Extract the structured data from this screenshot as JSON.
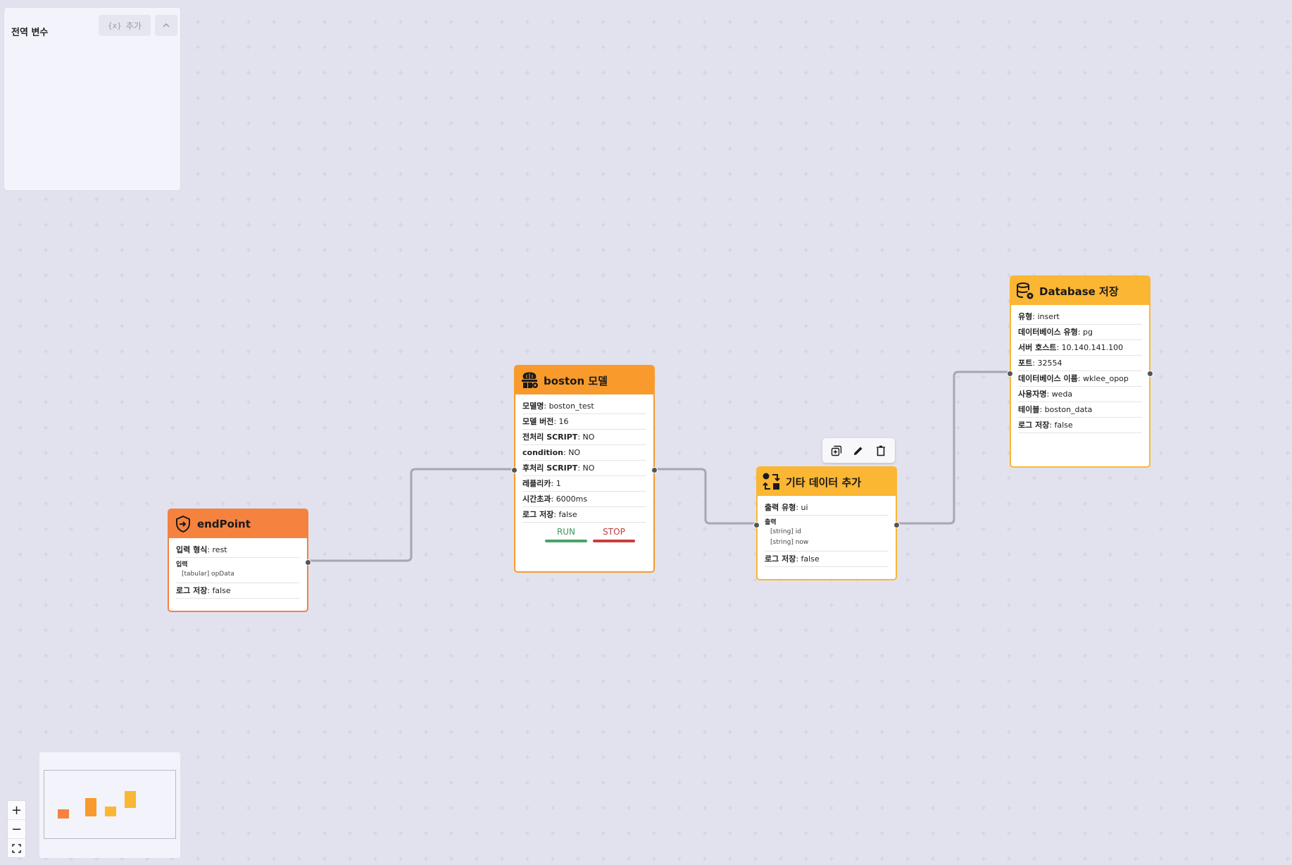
{
  "global_vars": {
    "title": "전역 변수",
    "add_icon_text": "{x}",
    "add_label": "추가"
  },
  "nodes": {
    "endpoint": {
      "title": "endPoint",
      "icon": "shield-enter-icon",
      "rows": [
        {
          "key": "입력 형식",
          "value": "rest"
        }
      ],
      "input": {
        "label": "입력",
        "items": [
          "[tabular]  opData"
        ]
      },
      "log": {
        "key": "로그 저장",
        "value": "false"
      }
    },
    "boston": {
      "title": "boston 모델",
      "icon": "brain-gear-icon",
      "rows": [
        {
          "key": "모델명",
          "value": "boston_test"
        },
        {
          "key": "모델 버전",
          "value": "16"
        },
        {
          "key": "전처리 SCRIPT",
          "value": "NO"
        },
        {
          "key": "condition",
          "value": "NO"
        },
        {
          "key": "후처리 SCRIPT",
          "value": "NO"
        },
        {
          "key": "레플리카",
          "value": "1"
        },
        {
          "key": "시간초과",
          "value": "6000ms"
        },
        {
          "key": "로그 저장",
          "value": "false"
        }
      ],
      "run_label": "RUN",
      "stop_label": "STOP"
    },
    "other_data": {
      "title": "기타 데이터 추가",
      "icon": "shapes-transform-icon",
      "rows": [
        {
          "key": "출력 유형",
          "value": "ui"
        }
      ],
      "output": {
        "label": "출력",
        "items": [
          "[string]  id",
          "[string]  now"
        ]
      },
      "log": {
        "key": "로그 저장",
        "value": "false"
      }
    },
    "database": {
      "title": "Database 저장",
      "icon": "database-gear-icon",
      "rows": [
        {
          "key": "유형",
          "value": "insert"
        },
        {
          "key": "데이터베이스 유형",
          "value": "pg"
        },
        {
          "key": "서버 호스트",
          "value": "10.140.141.100"
        },
        {
          "key": "포트",
          "value": "32554"
        },
        {
          "key": "데이터베이스 이름",
          "value": "wklee_opop"
        },
        {
          "key": "사용자명",
          "value": "weda"
        },
        {
          "key": "테이블",
          "value": "boston_data"
        },
        {
          "key": "로그 저장",
          "value": "false"
        }
      ]
    }
  },
  "toolbar": {
    "icons": [
      "duplicate-icon",
      "edit-pencil-icon",
      "trash-icon"
    ]
  },
  "zoom": {
    "in_label": "+",
    "out_label": "−"
  },
  "colors": {
    "endpoint": "#f6823f",
    "model": "#f89b2c",
    "other": "#fbb634",
    "database": "#fbb634",
    "run": "#4aa36b",
    "stop": "#c83d3d",
    "edge": "#a7a7ae"
  }
}
